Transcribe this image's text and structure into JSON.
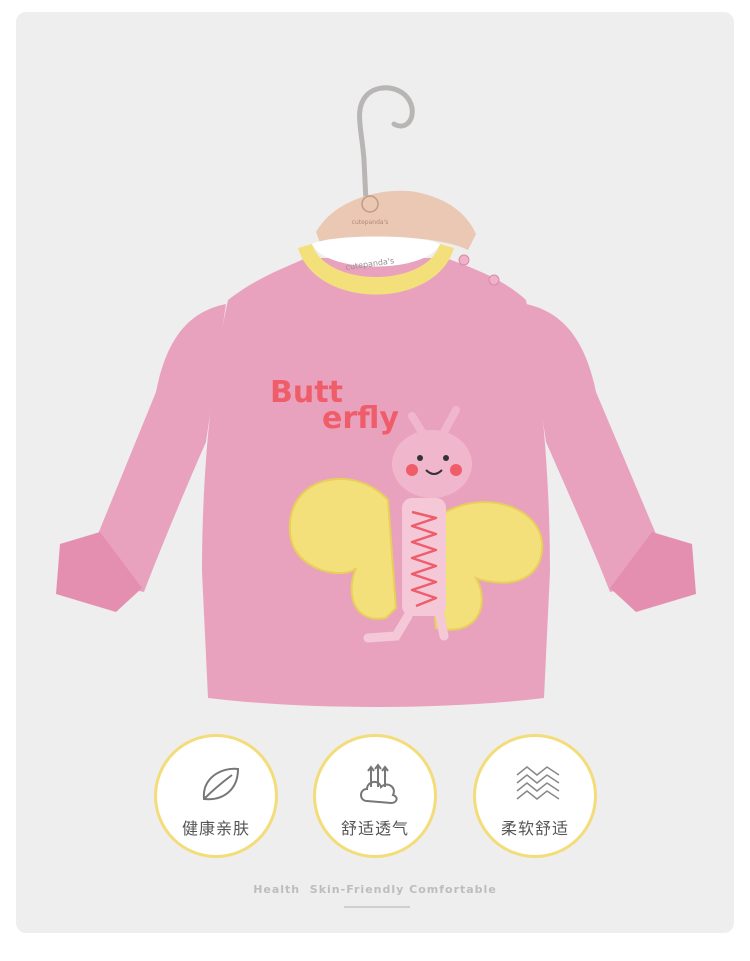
{
  "hanger": {
    "brand_text": "cutepanda's"
  },
  "shirt": {
    "collar_text": "cutepanda's",
    "print_line1": "Butt",
    "print_line2": "erfly",
    "colors": {
      "body": "#e9a2bd",
      "collar": "#f3e07a",
      "wing": "#f3e07a",
      "print": "#ef5d6a"
    }
  },
  "features": [
    {
      "icon": "leaf-icon",
      "label": "健康亲肤"
    },
    {
      "icon": "cloud-breathable-icon",
      "label": "舒适透气"
    },
    {
      "icon": "fabric-weave-icon",
      "label": "柔软舒适"
    }
  ],
  "tagline": "Health  Skin-Friendly Comfortable",
  "colors": {
    "background": "#efeeee",
    "badge_border": "#f3dc7a"
  }
}
